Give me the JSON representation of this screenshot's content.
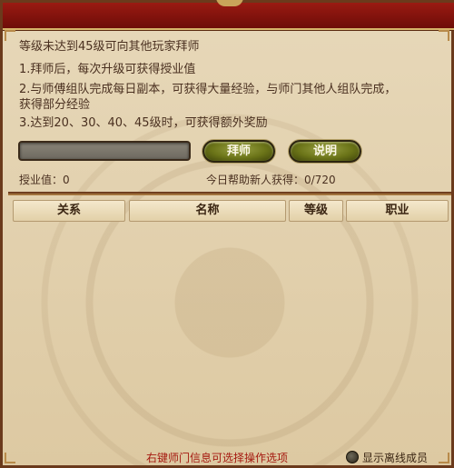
{
  "header": {
    "line1": "等级未达到45级可向其他玩家拜师",
    "line2": "1.拜师后，每次升级可获得授业值",
    "line3": "2.与师傅组队完成每日副本，可获得大量经验，与师门其他人组队完成，",
    "line4": "获得部分经验",
    "line5": "3.达到20、30、40、45级时，可获得额外奖励"
  },
  "input": {
    "value": "",
    "placeholder": ""
  },
  "buttons": {
    "apprentice": "拜师",
    "explain": "说明"
  },
  "stats": {
    "teaching_value": "授业值：0",
    "today_help": "今日帮助新人获得：0/720"
  },
  "table": {
    "columns": [
      "关系",
      "名称",
      "等级",
      "职业"
    ],
    "rows": []
  },
  "footer": {
    "hint": "右键师门信息可选择操作选项",
    "show_offline_label": "显示离线成员"
  }
}
